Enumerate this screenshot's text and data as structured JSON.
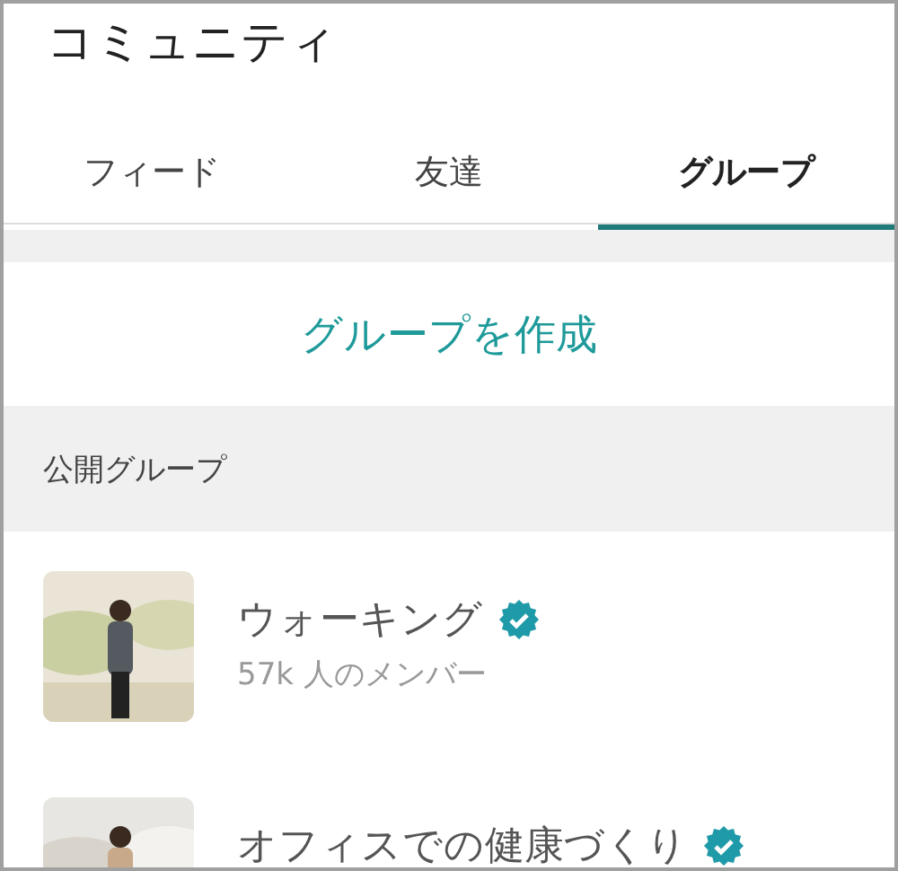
{
  "header": {
    "title": "コミュニティ"
  },
  "tabs": [
    {
      "label": "フィード",
      "selected": false
    },
    {
      "label": "友達",
      "selected": false
    },
    {
      "label": "グループ",
      "selected": true
    }
  ],
  "create_button": "グループを作成",
  "section": {
    "title": "公開グループ"
  },
  "groups": [
    {
      "name": "ウォーキング",
      "verified": true,
      "members": "57k 人のメンバー",
      "kind": "picture"
    },
    {
      "name": "オフィスでの健康づくり",
      "verified": true,
      "kind": "picture"
    }
  ]
}
